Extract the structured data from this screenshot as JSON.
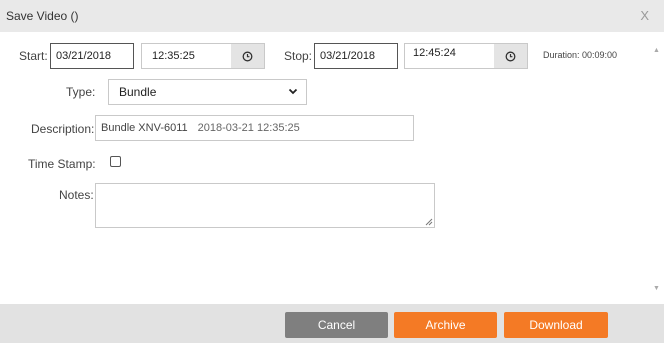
{
  "dialog": {
    "title": "Save Video ()",
    "close_label": "X"
  },
  "start": {
    "label": "Start:",
    "date": "03/21/2018",
    "time": "12:35:25"
  },
  "stop": {
    "label": "Stop:",
    "date": "03/21/2018",
    "time": "12:45:24"
  },
  "duration": "Duration: 00:09:00",
  "type": {
    "label": "Type:",
    "selected": "Bundle"
  },
  "description": {
    "label": "Description:",
    "name": "Bundle XNV-6011",
    "timestamp": "2018-03-21 12:35:25"
  },
  "timestamp": {
    "label": "Time Stamp:",
    "checked": false
  },
  "notes": {
    "label": "Notes:",
    "value": ""
  },
  "footer": {
    "cancel_label": "Cancel",
    "archive_label": "Archive",
    "download_label": "Download"
  },
  "icons": {
    "clock": "clock-icon",
    "chevron": "chevron-down-icon",
    "resize": "resize-grip-icon"
  },
  "colors": {
    "accent": "#f47a25",
    "cancel": "#7f7f7f",
    "titlebar": "#e9e9e9",
    "footer": "#e2e2e2"
  }
}
